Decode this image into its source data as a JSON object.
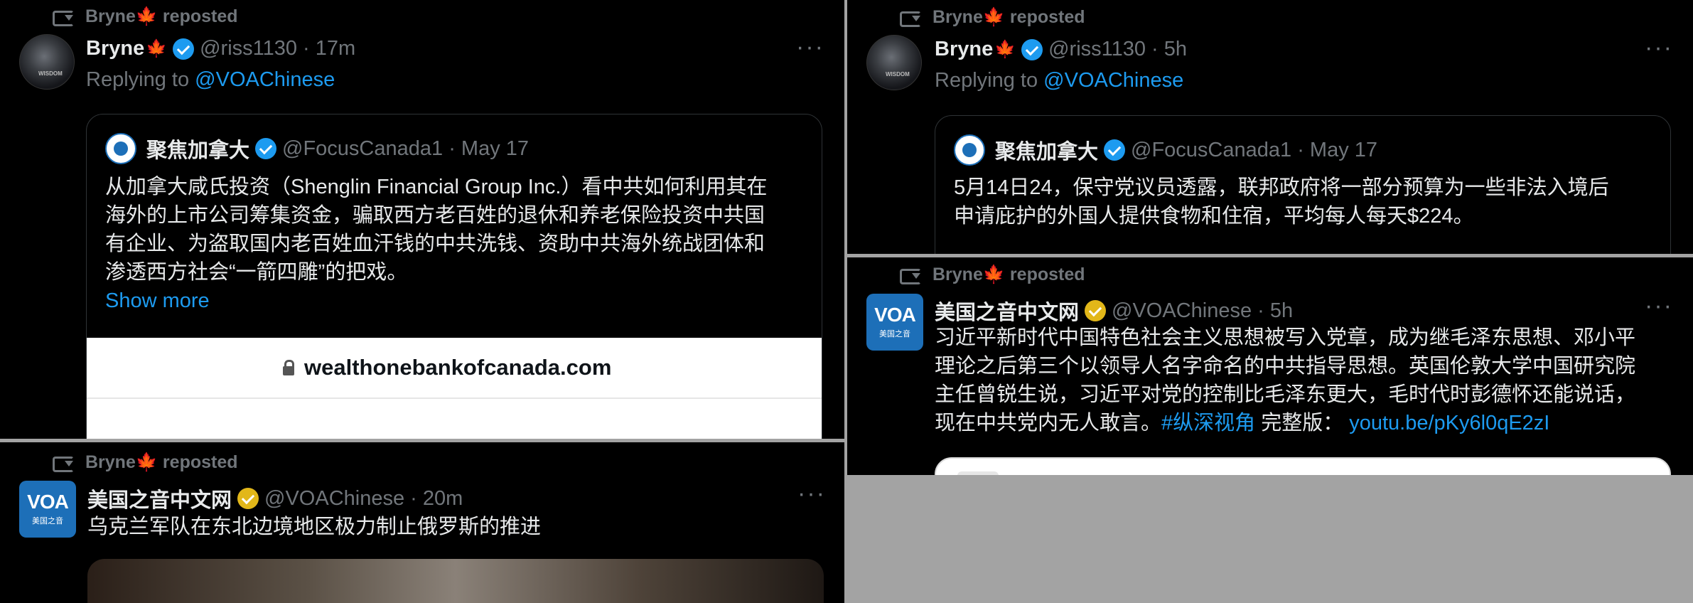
{
  "panels": {
    "top_left": {
      "repost_label": "Bryne🍁 reposted",
      "author": {
        "name": "Bryne",
        "flag": "🍁",
        "handle": "@riss1130 · 17m",
        "avatar_text": "WISDOM"
      },
      "replying_to_prefix": "Replying to ",
      "replying_to_handle": "@VOAChinese",
      "quote": {
        "author_name": "聚焦加拿大",
        "handle_time": "@FocusCanada1 · May 17",
        "lines": [
          "从加拿大咸氏投资（Shenglin Financial Group Inc.）看中共如何利用其在",
          "海外的上市公司筹集资金，骗取西方老百姓的退休和养老保险投资中共国",
          "有企业、为盗取国内老百姓血汗钱的中共洗钱、资助中共海外统战团体和",
          "渗透西方社会“一箭四雕”的把戏。"
        ],
        "show_more": "Show more",
        "link_domain": "wealthonebankofcanada.com"
      }
    },
    "bottom_left": {
      "repost_label": "Bryne🍁 reposted",
      "author": {
        "name": "美国之音中文网",
        "handle": "@VOAChinese · 20m",
        "avatar_logo": "VOA",
        "avatar_sub": "美国之音"
      },
      "text": "乌克兰军队在东北边境地区极力制止俄罗斯的推进"
    },
    "top_right": {
      "repost_label": "Bryne🍁 reposted",
      "author": {
        "name": "Bryne",
        "flag": "🍁",
        "handle": "@riss1130 · 5h",
        "avatar_text": "WISDOM"
      },
      "replying_to_prefix": "Replying to ",
      "replying_to_handle": "@VOAChinese",
      "quote": {
        "author_name": "聚焦加拿大",
        "handle_time": "@FocusCanada1 · May 17",
        "lines": [
          "5月14日24，保守党议员透露，联邦政府将一部分预算为一些非法入境后",
          "申请庇护的外国人提供食物和住宿，平均每人每天$224。"
        ]
      }
    },
    "middle_right": {
      "repost_label": "Bryne🍁 reposted",
      "author": {
        "name": "美国之音中文网",
        "handle": "@VOAChinese · 5h",
        "avatar_logo": "VOA",
        "avatar_sub": "美国之音"
      },
      "lines": [
        "习近平新时代中国特色社会主义思想被写入党章，成为继毛泽东思想、邓小平",
        "理论之后第三个以领导人名字命名的中共指导思想。英国伦敦大学中国研究院",
        "主任曾锐生说，习近平对党的控制比毛泽东更大，毛时代时彭德怀还能说话，"
      ],
      "last_line_text": "现在中共党内无人敢言。",
      "hashtag": "#纵深视角",
      "full_version_label": " 完整版：",
      "url": "youtu.be/pKy6l0qE2zI"
    }
  },
  "more_label": "···",
  "colors": {
    "background": "#000000",
    "text": "#e7e9ea",
    "muted": "#71767b",
    "link": "#1d9bf0",
    "verified_blue": "#1d9bf0",
    "verified_gold": "#e2b719",
    "voa_blue": "#1d6fb8"
  }
}
